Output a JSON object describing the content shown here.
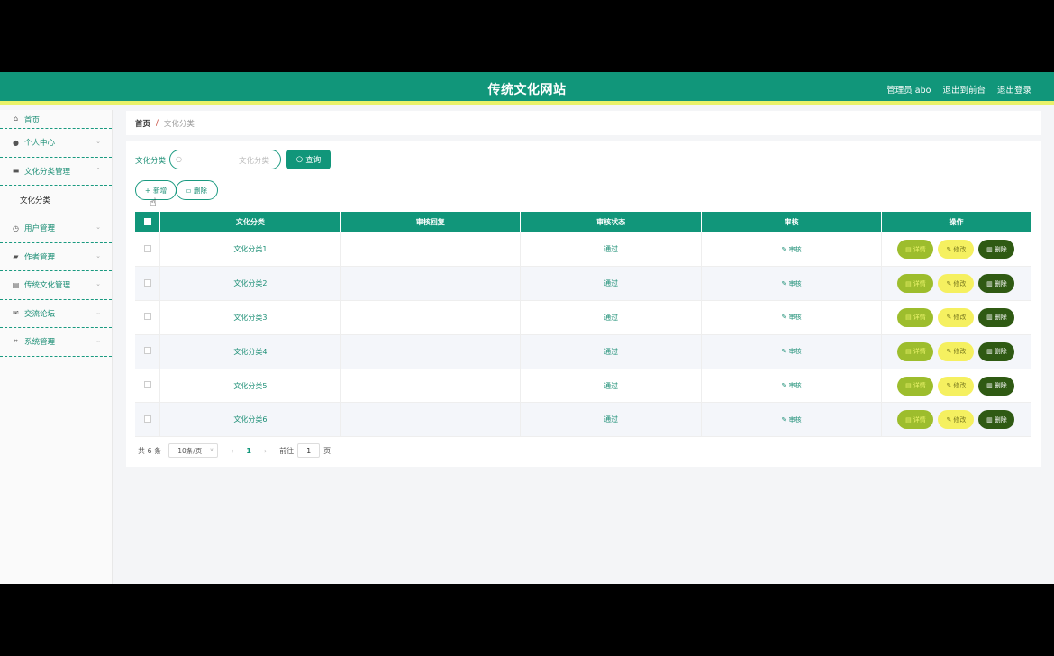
{
  "header": {
    "title": "传统文化网站",
    "admin_label": "管理员 abo",
    "front_link": "退出到前台",
    "logout_link": "退出登录"
  },
  "sidebar": {
    "items": [
      {
        "label": "首页",
        "icon": "home-icon"
      },
      {
        "label": "个人中心",
        "icon": "user-icon"
      },
      {
        "label": "文化分类管理",
        "icon": "category-icon",
        "expanded": true
      },
      {
        "label": "用户管理",
        "icon": "clock-icon"
      },
      {
        "label": "作者管理",
        "icon": "ticket-icon"
      },
      {
        "label": "传统文化管理",
        "icon": "print-icon"
      },
      {
        "label": "交流论坛",
        "icon": "mail-icon"
      },
      {
        "label": "系统管理",
        "icon": "crop-icon"
      }
    ],
    "subitem": "文化分类"
  },
  "breadcrumb": {
    "home": "首页",
    "sep": "/",
    "current": "文化分类"
  },
  "search": {
    "label": "文化分类",
    "placeholder": "文化分类",
    "button": "查询"
  },
  "actions": {
    "add": "新增",
    "delete": "删除"
  },
  "table": {
    "headers": [
      "文化分类",
      "审核回复",
      "审核状态",
      "审核",
      "操作"
    ],
    "rows": [
      {
        "name": "文化分类1",
        "reply": "",
        "status": "通过",
        "audit": "审核"
      },
      {
        "name": "文化分类2",
        "reply": "",
        "status": "通过",
        "audit": "审核"
      },
      {
        "name": "文化分类3",
        "reply": "",
        "status": "通过",
        "audit": "审核"
      },
      {
        "name": "文化分类4",
        "reply": "",
        "status": "通过",
        "audit": "审核"
      },
      {
        "name": "文化分类5",
        "reply": "",
        "status": "通过",
        "audit": "审核"
      },
      {
        "name": "文化分类6",
        "reply": "",
        "status": "通过",
        "audit": "审核"
      }
    ],
    "op_labels": {
      "detail": "详情",
      "edit": "修改",
      "delete": "删除"
    }
  },
  "pagination": {
    "total": "共 6 条",
    "page_size": "10条/页",
    "current_page": "1",
    "goto_label": "前往",
    "goto_value": "1",
    "page_suffix": "页"
  },
  "colors": {
    "primary": "#11967a",
    "accent": "#e9f26a",
    "detail": "#9dbd2d",
    "edit": "#f5f060",
    "delete": "#2f5a13"
  }
}
